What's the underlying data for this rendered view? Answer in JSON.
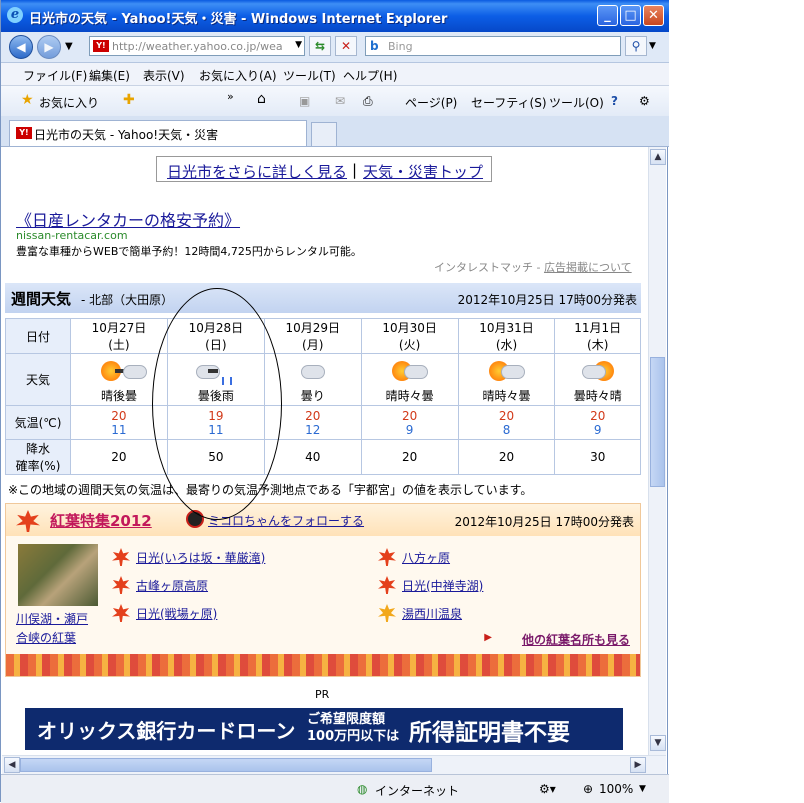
{
  "window": {
    "title": "日光市の天気 - Yahoo!天気・災害 - Windows Internet Explorer",
    "controls": {
      "minimize": "_",
      "maximize": "□",
      "close": "✕"
    }
  },
  "address": {
    "url": "http://weather.yahoo.co.jp/weathe",
    "search_placeholder": "Bing"
  },
  "menu": [
    "ファイル(F)",
    "編集(E)",
    "表示(V)",
    "お気に入り(A)",
    "ツール(T)",
    "ヘルプ(H)"
  ],
  "favorites_bar": {
    "favorites": "お気に入り",
    "page": "ページ(P)",
    "safety": "セーフティ(S)",
    "tools": "ツール(O)"
  },
  "tab": {
    "label": "日光市の天気 - Yahoo!天気・災害"
  },
  "content": {
    "top_links": {
      "detail": "日光市をさらに詳しく見る",
      "sep": "|",
      "top": "天気・災害トップ"
    },
    "ad": {
      "title": "《日産レンタカーの格安予約》",
      "url": "nissan-rentacar.com",
      "desc": "豊富な車種からWEBで簡単予約！12時間4,725円からレンタル可能。",
      "note_prefix": "インタレストマッチ - ",
      "note_link": "広告掲載について"
    },
    "weekly": {
      "title": "週間天気",
      "subtitle": "- 北部（大田原）",
      "published": "2012年10月25日 17時00分発表",
      "row_labels": {
        "date": "日付",
        "weather": "天気",
        "temp": "気温(℃)",
        "rain1": "降水",
        "rain2": "確率(%)"
      },
      "days": [
        {
          "date": "10月27日",
          "dow": "(土)",
          "icon": "sun-then-cloud-icon",
          "weather": "晴後曇",
          "high": "20",
          "low": "11",
          "rain": "20"
        },
        {
          "date": "10月28日",
          "dow": "(日)",
          "icon": "cloud-then-rain-icon",
          "weather": "曇後雨",
          "high": "19",
          "low": "11",
          "rain": "50"
        },
        {
          "date": "10月29日",
          "dow": "(月)",
          "icon": "cloud-icon",
          "weather": "曇り",
          "high": "20",
          "low": "12",
          "rain": "40"
        },
        {
          "date": "10月30日",
          "dow": "(火)",
          "icon": "sun-sometimes-cloud-icon",
          "weather": "晴時々曇",
          "high": "20",
          "low": "9",
          "rain": "20"
        },
        {
          "date": "10月31日",
          "dow": "(水)",
          "icon": "sun-sometimes-cloud-icon",
          "weather": "晴時々曇",
          "high": "20",
          "low": "8",
          "rain": "20"
        },
        {
          "date": "11月1日",
          "dow": "(木)",
          "icon": "cloud-sometimes-sun-icon",
          "weather": "曇時々晴",
          "high": "20",
          "low": "9",
          "rain": "30"
        }
      ],
      "note": "※この地域の週間天気の気温は、最寄りの気温予測地点である「宇都宮」の値を表示しています。"
    },
    "kouyou": {
      "title": "紅葉特集2012",
      "follow": "ミコロちゃんをフォローする",
      "published": "2012年10月25日 17時00分発表",
      "photo_caption_1": "川俣湖・瀬戸",
      "photo_caption_2": "合峡の紅葉",
      "links_left": [
        "日光(いろは坂・華厳滝)",
        "古峰ヶ原高原",
        "日光(戦場ヶ原)"
      ],
      "links_right": [
        "八方ヶ原",
        "日光(中禅寺湖)",
        "湯西川温泉"
      ],
      "more": "他の紅葉名所も見る"
    },
    "pr": "PR",
    "banner": {
      "main": "オリックス銀行カードローン",
      "sub1": "ご希望限度額",
      "sub2": "100万円以下は",
      "big": "所得証明書不要"
    }
  },
  "status": {
    "zone": "インターネット",
    "zoom": "100%"
  }
}
